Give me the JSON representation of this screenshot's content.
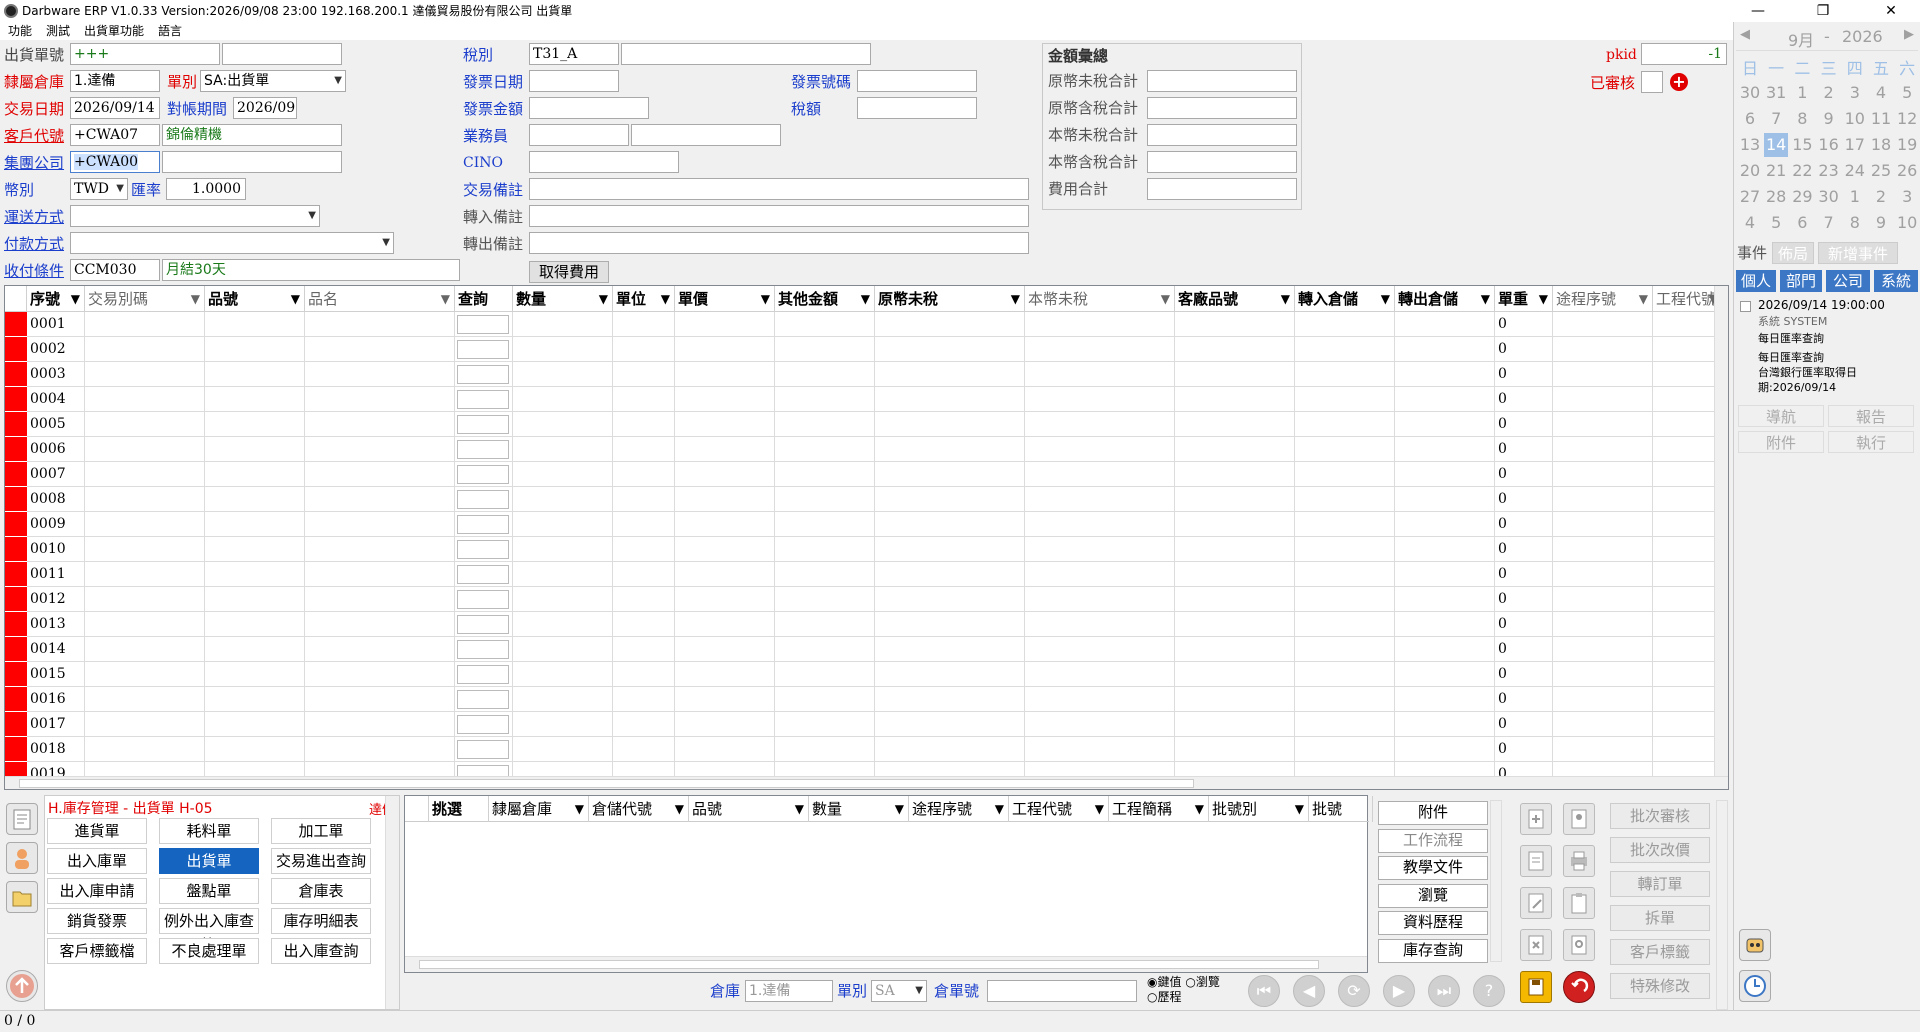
{
  "window": {
    "title": "Darbware ERP V1.0.33 Version:2026/09/08 23:00   192.168.200.1 達儀貿易股份有限公司 出貨單"
  },
  "menu": [
    "功能",
    "測試",
    "出貨單功能",
    "語言"
  ],
  "form": {
    "ship_no_label": "出貨單號",
    "ship_no": "+++",
    "warehouse_label": "隸屬倉庫",
    "warehouse": "1.達備",
    "doctype_label": "單別",
    "doctype": "SA:出貨單",
    "txdate_label": "交易日期",
    "txdate": "2026/09/14",
    "period_label": "對帳期間",
    "period": "2026/09",
    "cust_label": "客戶代號",
    "cust_code": "+CWA07",
    "cust_name": "錦倫精機",
    "group_label": "集團公司",
    "group_code": "+CWA00",
    "currency_label": "幣別",
    "currency": "TWD",
    "rate_label": "匯率",
    "rate": "1.0000",
    "ship_method_label": "運送方式",
    "pay_method_label": "付款方式",
    "terms_label": "收付條件",
    "terms_code": "CCM030",
    "terms_name": "月結30天",
    "tax_label": "稅別",
    "tax": "T31_A",
    "inv_date_label": "發票日期",
    "inv_no_label": "發票號碼",
    "inv_amt_label": "發票金額",
    "tax_amt_label": "稅額",
    "sales_label": "業務員",
    "cino_label": "CINO",
    "tx_note_label": "交易備註",
    "in_note_label": "轉入備註",
    "out_note_label": "轉出備註",
    "get_fee_button": "取得費用",
    "pkid_label": "pkid",
    "pkid": "-1",
    "approved_label": "已審核"
  },
  "totals": {
    "title": "金額彙總",
    "rows": [
      "原幣未稅合計",
      "原幣含稅合計",
      "本幣未稅合計",
      "本幣含稅合計",
      "費用合計"
    ]
  },
  "grid": {
    "columns": [
      "序號",
      "交易別碼",
      "品號",
      "品名",
      "查詢",
      "數量",
      "單位",
      "單價",
      "其他金額",
      "原幣未稅",
      "本幣未稅",
      "客廠品號",
      "轉入倉儲",
      "轉出倉儲",
      "單重",
      "途程序號",
      "工程代號"
    ],
    "rows": [
      "0001",
      "0002",
      "0003",
      "0004",
      "0005",
      "0006",
      "0007",
      "0008",
      "0009",
      "0010",
      "0011",
      "0012",
      "0013",
      "0014",
      "0015",
      "0016",
      "0017",
      "0018",
      "0019"
    ],
    "weight_default": "0"
  },
  "calendar": {
    "month": "9月",
    "year": "2026",
    "weekdays": [
      "日",
      "一",
      "二",
      "三",
      "四",
      "五",
      "六"
    ],
    "weeks": [
      [
        "30",
        "31",
        "1",
        "2",
        "3",
        "4",
        "5"
      ],
      [
        "6",
        "7",
        "8",
        "9",
        "10",
        "11",
        "12"
      ],
      [
        "13",
        "14",
        "15",
        "16",
        "17",
        "18",
        "19"
      ],
      [
        "20",
        "21",
        "22",
        "23",
        "24",
        "25",
        "26"
      ],
      [
        "27",
        "28",
        "29",
        "30",
        "1",
        "2",
        "3"
      ],
      [
        "4",
        "5",
        "6",
        "7",
        "8",
        "9",
        "10"
      ]
    ],
    "today": "14"
  },
  "events": {
    "tabs": [
      "事件",
      "佈局",
      "新增事件"
    ],
    "scopes": [
      "個人",
      "部門",
      "公司",
      "系統"
    ],
    "item_time": "2026/09/14 19:00:00",
    "item_sender": "系統  SYSTEM",
    "item_title": "每日匯率查詢",
    "item_body1": "每日匯率查詢",
    "item_body2": "台灣銀行匯率取得日",
    "item_body3": "期:2026/09/14",
    "actions": [
      "導航",
      "報告",
      "附件",
      "執行"
    ]
  },
  "module": {
    "title": "H.庫存管理 - 出貨單  H-05",
    "user": "達備",
    "buttons": [
      "進貨單",
      "耗料單",
      "加工單",
      "出入庫單",
      "出貨單",
      "交易進出查詢",
      "出入庫申請",
      "盤點單",
      "倉庫表",
      "銷貨發票",
      "例外出入庫查詢",
      "庫存明細表",
      "客戶標籤檔",
      "不良處理單",
      "出入庫查詢"
    ]
  },
  "subgrid": {
    "columns": [
      "挑選",
      "隸屬倉庫",
      "倉儲代號",
      "品號",
      "數量",
      "途程序號",
      "工程代號",
      "工程簡稱",
      "批號別",
      "批號"
    ]
  },
  "tools": [
    "附件",
    "工作流程",
    "教學文件",
    "瀏覽",
    "資料歷程",
    "庫存查詢"
  ],
  "filters": {
    "warehouse_label": "倉庫",
    "warehouse": "1.達備",
    "doctype_label": "單別",
    "doctype": "SA",
    "no_label": "倉單號",
    "radio1": "鍵值",
    "radio2": "瀏覽",
    "radio3": "歷程"
  },
  "batch": [
    "批次審核",
    "批次改價",
    "轉訂單",
    "拆單",
    "客戶標籤",
    "特殊修改"
  ],
  "status": {
    "text": "0 / 0"
  }
}
